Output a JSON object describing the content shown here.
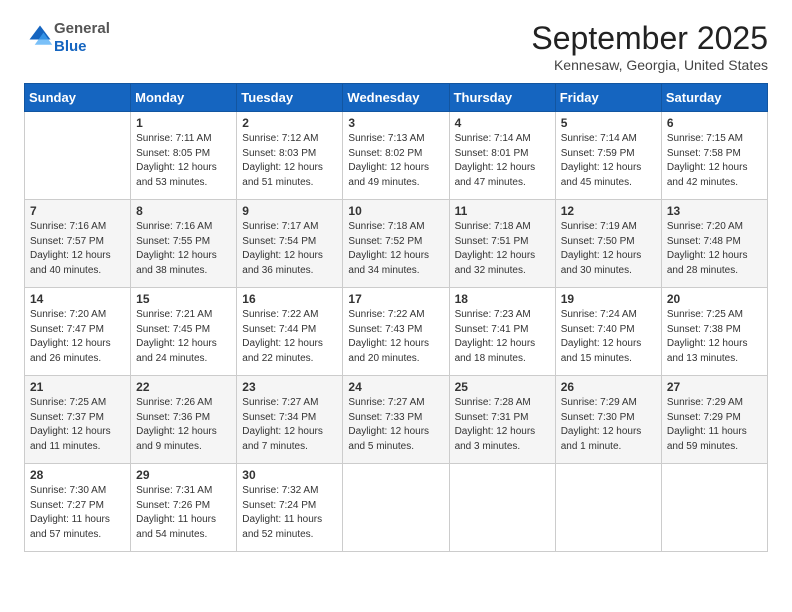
{
  "logo": {
    "general": "General",
    "blue": "Blue"
  },
  "title": "September 2025",
  "location": "Kennesaw, Georgia, United States",
  "days_of_week": [
    "Sunday",
    "Monday",
    "Tuesday",
    "Wednesday",
    "Thursday",
    "Friday",
    "Saturday"
  ],
  "weeks": [
    [
      {
        "day": "",
        "info": []
      },
      {
        "day": "1",
        "info": [
          "Sunrise: 7:11 AM",
          "Sunset: 8:05 PM",
          "Daylight: 12 hours",
          "and 53 minutes."
        ]
      },
      {
        "day": "2",
        "info": [
          "Sunrise: 7:12 AM",
          "Sunset: 8:03 PM",
          "Daylight: 12 hours",
          "and 51 minutes."
        ]
      },
      {
        "day": "3",
        "info": [
          "Sunrise: 7:13 AM",
          "Sunset: 8:02 PM",
          "Daylight: 12 hours",
          "and 49 minutes."
        ]
      },
      {
        "day": "4",
        "info": [
          "Sunrise: 7:14 AM",
          "Sunset: 8:01 PM",
          "Daylight: 12 hours",
          "and 47 minutes."
        ]
      },
      {
        "day": "5",
        "info": [
          "Sunrise: 7:14 AM",
          "Sunset: 7:59 PM",
          "Daylight: 12 hours",
          "and 45 minutes."
        ]
      },
      {
        "day": "6",
        "info": [
          "Sunrise: 7:15 AM",
          "Sunset: 7:58 PM",
          "Daylight: 12 hours",
          "and 42 minutes."
        ]
      }
    ],
    [
      {
        "day": "7",
        "info": [
          "Sunrise: 7:16 AM",
          "Sunset: 7:57 PM",
          "Daylight: 12 hours",
          "and 40 minutes."
        ]
      },
      {
        "day": "8",
        "info": [
          "Sunrise: 7:16 AM",
          "Sunset: 7:55 PM",
          "Daylight: 12 hours",
          "and 38 minutes."
        ]
      },
      {
        "day": "9",
        "info": [
          "Sunrise: 7:17 AM",
          "Sunset: 7:54 PM",
          "Daylight: 12 hours",
          "and 36 minutes."
        ]
      },
      {
        "day": "10",
        "info": [
          "Sunrise: 7:18 AM",
          "Sunset: 7:52 PM",
          "Daylight: 12 hours",
          "and 34 minutes."
        ]
      },
      {
        "day": "11",
        "info": [
          "Sunrise: 7:18 AM",
          "Sunset: 7:51 PM",
          "Daylight: 12 hours",
          "and 32 minutes."
        ]
      },
      {
        "day": "12",
        "info": [
          "Sunrise: 7:19 AM",
          "Sunset: 7:50 PM",
          "Daylight: 12 hours",
          "and 30 minutes."
        ]
      },
      {
        "day": "13",
        "info": [
          "Sunrise: 7:20 AM",
          "Sunset: 7:48 PM",
          "Daylight: 12 hours",
          "and 28 minutes."
        ]
      }
    ],
    [
      {
        "day": "14",
        "info": [
          "Sunrise: 7:20 AM",
          "Sunset: 7:47 PM",
          "Daylight: 12 hours",
          "and 26 minutes."
        ]
      },
      {
        "day": "15",
        "info": [
          "Sunrise: 7:21 AM",
          "Sunset: 7:45 PM",
          "Daylight: 12 hours",
          "and 24 minutes."
        ]
      },
      {
        "day": "16",
        "info": [
          "Sunrise: 7:22 AM",
          "Sunset: 7:44 PM",
          "Daylight: 12 hours",
          "and 22 minutes."
        ]
      },
      {
        "day": "17",
        "info": [
          "Sunrise: 7:22 AM",
          "Sunset: 7:43 PM",
          "Daylight: 12 hours",
          "and 20 minutes."
        ]
      },
      {
        "day": "18",
        "info": [
          "Sunrise: 7:23 AM",
          "Sunset: 7:41 PM",
          "Daylight: 12 hours",
          "and 18 minutes."
        ]
      },
      {
        "day": "19",
        "info": [
          "Sunrise: 7:24 AM",
          "Sunset: 7:40 PM",
          "Daylight: 12 hours",
          "and 15 minutes."
        ]
      },
      {
        "day": "20",
        "info": [
          "Sunrise: 7:25 AM",
          "Sunset: 7:38 PM",
          "Daylight: 12 hours",
          "and 13 minutes."
        ]
      }
    ],
    [
      {
        "day": "21",
        "info": [
          "Sunrise: 7:25 AM",
          "Sunset: 7:37 PM",
          "Daylight: 12 hours",
          "and 11 minutes."
        ]
      },
      {
        "day": "22",
        "info": [
          "Sunrise: 7:26 AM",
          "Sunset: 7:36 PM",
          "Daylight: 12 hours",
          "and 9 minutes."
        ]
      },
      {
        "day": "23",
        "info": [
          "Sunrise: 7:27 AM",
          "Sunset: 7:34 PM",
          "Daylight: 12 hours",
          "and 7 minutes."
        ]
      },
      {
        "day": "24",
        "info": [
          "Sunrise: 7:27 AM",
          "Sunset: 7:33 PM",
          "Daylight: 12 hours",
          "and 5 minutes."
        ]
      },
      {
        "day": "25",
        "info": [
          "Sunrise: 7:28 AM",
          "Sunset: 7:31 PM",
          "Daylight: 12 hours",
          "and 3 minutes."
        ]
      },
      {
        "day": "26",
        "info": [
          "Sunrise: 7:29 AM",
          "Sunset: 7:30 PM",
          "Daylight: 12 hours",
          "and 1 minute."
        ]
      },
      {
        "day": "27",
        "info": [
          "Sunrise: 7:29 AM",
          "Sunset: 7:29 PM",
          "Daylight: 11 hours",
          "and 59 minutes."
        ]
      }
    ],
    [
      {
        "day": "28",
        "info": [
          "Sunrise: 7:30 AM",
          "Sunset: 7:27 PM",
          "Daylight: 11 hours",
          "and 57 minutes."
        ]
      },
      {
        "day": "29",
        "info": [
          "Sunrise: 7:31 AM",
          "Sunset: 7:26 PM",
          "Daylight: 11 hours",
          "and 54 minutes."
        ]
      },
      {
        "day": "30",
        "info": [
          "Sunrise: 7:32 AM",
          "Sunset: 7:24 PM",
          "Daylight: 11 hours",
          "and 52 minutes."
        ]
      },
      {
        "day": "",
        "info": []
      },
      {
        "day": "",
        "info": []
      },
      {
        "day": "",
        "info": []
      },
      {
        "day": "",
        "info": []
      }
    ]
  ]
}
